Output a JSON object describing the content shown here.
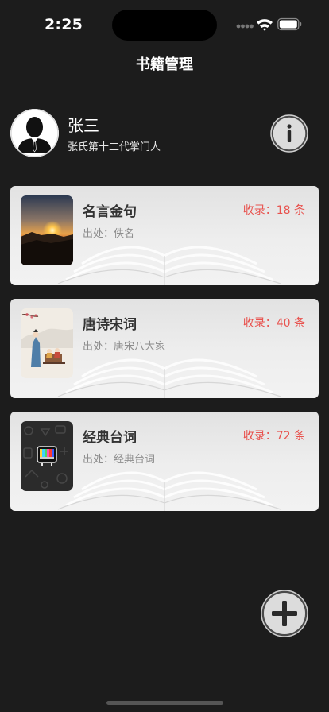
{
  "status_bar": {
    "time": "2:25"
  },
  "nav": {
    "title": "书籍管理"
  },
  "profile": {
    "name": "张三",
    "subtitle": "张氏第十二代掌门人"
  },
  "books": [
    {
      "title": "名言金句",
      "source": "出处：佚名",
      "count": "收录：18 条",
      "cover_icon": "sunset-image"
    },
    {
      "title": "唐诗宋词",
      "source": "出处：唐宋八大家",
      "count": "收录：40 条",
      "cover_icon": "ancient-painting-image"
    },
    {
      "title": "经典台词",
      "source": "出处：经典台词",
      "count": "收录：72 条",
      "cover_icon": "tv-pattern-image"
    }
  ],
  "colors": {
    "background": "#1c1c1c",
    "count_accent": "#e8524e",
    "card": "#ebebeb"
  }
}
